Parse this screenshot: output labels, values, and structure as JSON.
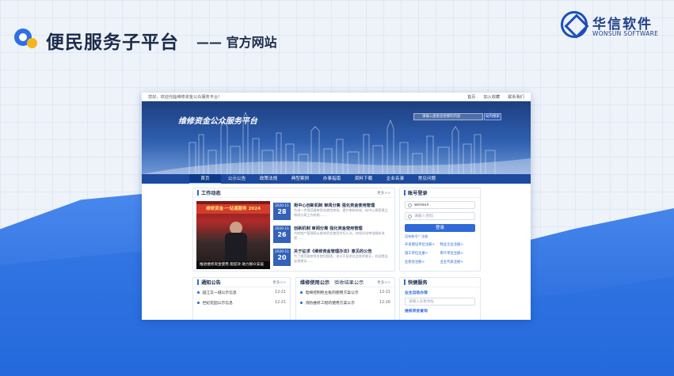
{
  "header": {
    "title": "便民服务子平台",
    "subtitle": "—— 官方网站",
    "brand_cn": "华信软件",
    "brand_en": "WONSUN SOFTWARE"
  },
  "site": {
    "welcome": "您好，欢迎光临维修资金公众服务平台!",
    "top_links": [
      "首页",
      "加入收藏",
      "联系我们"
    ],
    "name": "维修资金公众服务平台",
    "search_placeholder": "请输入搜索您想要的内容",
    "search_button": "站内搜索",
    "nav": [
      "首页",
      "公示公告",
      "政策法规",
      "典型案例",
      "办事指南",
      "资料下载",
      "企业名录",
      "常见问题"
    ]
  },
  "news": {
    "title": "工作动态",
    "more": "更多>>",
    "photo_banner": "维修资金·一站通服务 2024",
    "photo_caption": "推进维修资金使用 能提效 助力群众安居",
    "items": [
      {
        "ym": "2020-11",
        "day": "28",
        "head": "街中心创新机制 审阅分离 强化资金使用管理",
        "sum": "为进一步规范维修资金使用审批，提升审核质效，街中心探索建立审阅分离工作机制……"
      },
      {
        "ym": "2020-11",
        "day": "26",
        "head": "创新机制 审阅分离 强化资金使用管理",
        "sum": "市房地产管理局以维修资金使用为切入点，持续优化审批服务流程……"
      },
      {
        "ym": "2020-11",
        "day": "20",
        "head": "关于征求《维修资金管理办法》意见的公告",
        "sum": "为了规范维修资金使用管理，现公开征求社会各界意见，欢迎提出宝贵建议……"
      }
    ]
  },
  "login": {
    "title": "账号登录",
    "username": "wonsun",
    "password_placeholder": "请输入密码",
    "button": "登录",
    "register": "没有账号？注册",
    "links": [
      "开发建设单位注册>",
      "物业企业注册>",
      "施工单位注册>",
      "审计单位注册>",
      "业委会注册>",
      "业主代表注册>"
    ]
  },
  "notice": {
    "title": "通知公告",
    "more": "更多>>",
    "items": [
      {
        "text": "园江又一城公示信息",
        "date": "12-21"
      },
      {
        "text": "世纪花园公示信息",
        "date": "12-21"
      }
    ]
  },
  "publicity": {
    "tab1": "维修使用公示",
    "tab2": "验收结果公示",
    "more": "更多>>",
    "items": [
      {
        "text": "电梯控制柜主板的使用方案公示",
        "date": "12-21"
      },
      {
        "text": "消防维修工程的使用方案公示",
        "date": "12-16"
      }
    ]
  },
  "quick": {
    "title": "快捷服务",
    "label1": "业主自助办理",
    "placeholder": "请输入房屋地址",
    "label2": "维修资金查询"
  }
}
